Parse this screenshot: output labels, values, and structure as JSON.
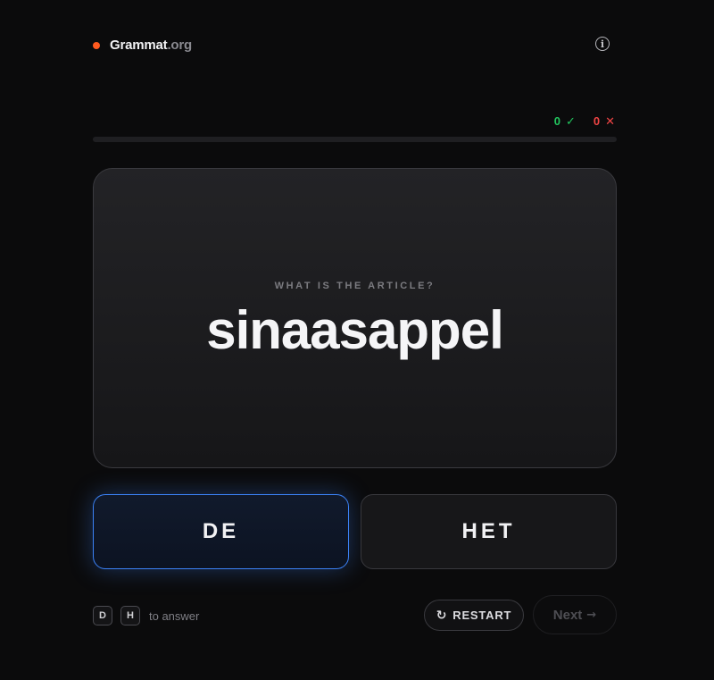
{
  "brand": {
    "name": "Grammat",
    "tld": ".org"
  },
  "info_icon": "info-icon",
  "score": {
    "correct": "0",
    "correct_symbol": "✓",
    "wrong": "0",
    "wrong_symbol": "✕"
  },
  "progress": {
    "fraction": 0
  },
  "card": {
    "prompt": "WHAT IS THE ARTICLE?",
    "word": "sinaasappel"
  },
  "answers": {
    "de": "DE",
    "het": "HET"
  },
  "footer": {
    "key_de": "D",
    "key_het": "H",
    "hint": "to answer",
    "restart": "RESTART",
    "restart_icon": "↻",
    "next": "Next",
    "next_arrow": "→"
  },
  "colors": {
    "brand_dot": "#ff5a1f",
    "correct": "#22c55e",
    "wrong": "#ef4444",
    "selected_accent": "#3b82f6",
    "background": "#0b0b0c"
  }
}
